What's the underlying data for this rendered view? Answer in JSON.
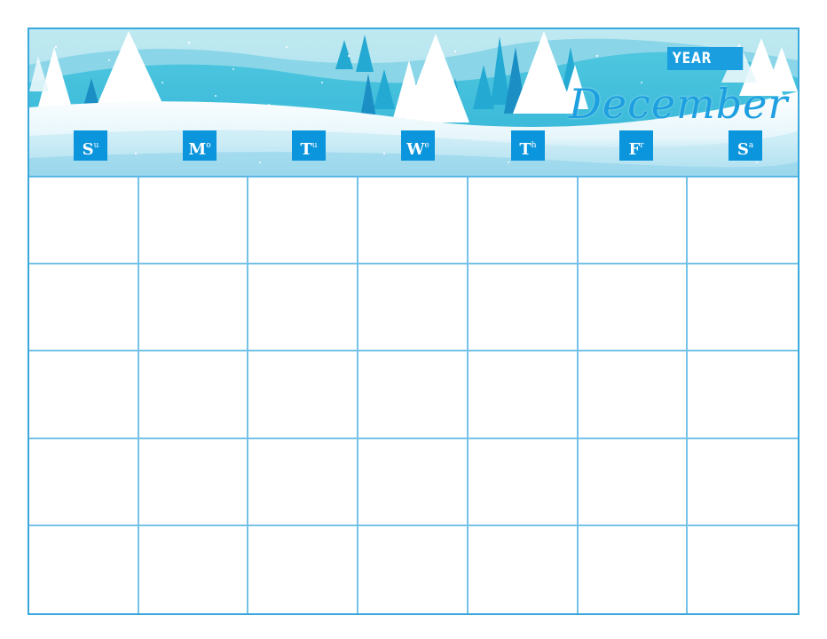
{
  "calendar": {
    "year_label": "YEAR",
    "month": "December",
    "weekdays": [
      {
        "main": "S",
        "sup": "u"
      },
      {
        "main": "M",
        "sup": "o"
      },
      {
        "main": "T",
        "sup": "u"
      },
      {
        "main": "W",
        "sup": "e"
      },
      {
        "main": "T",
        "sup": "h"
      },
      {
        "main": "F",
        "sup": "r"
      },
      {
        "main": "S",
        "sup": "a"
      }
    ],
    "rows": 5,
    "columns": 7
  },
  "colors": {
    "accent": "#0b95dc",
    "border": "#39a9dc",
    "sky": "#a9e2ee",
    "hill": "#3dbfdc",
    "snow": "#ffffff"
  },
  "icons": {
    "banner": "winter-forest-illustration"
  }
}
